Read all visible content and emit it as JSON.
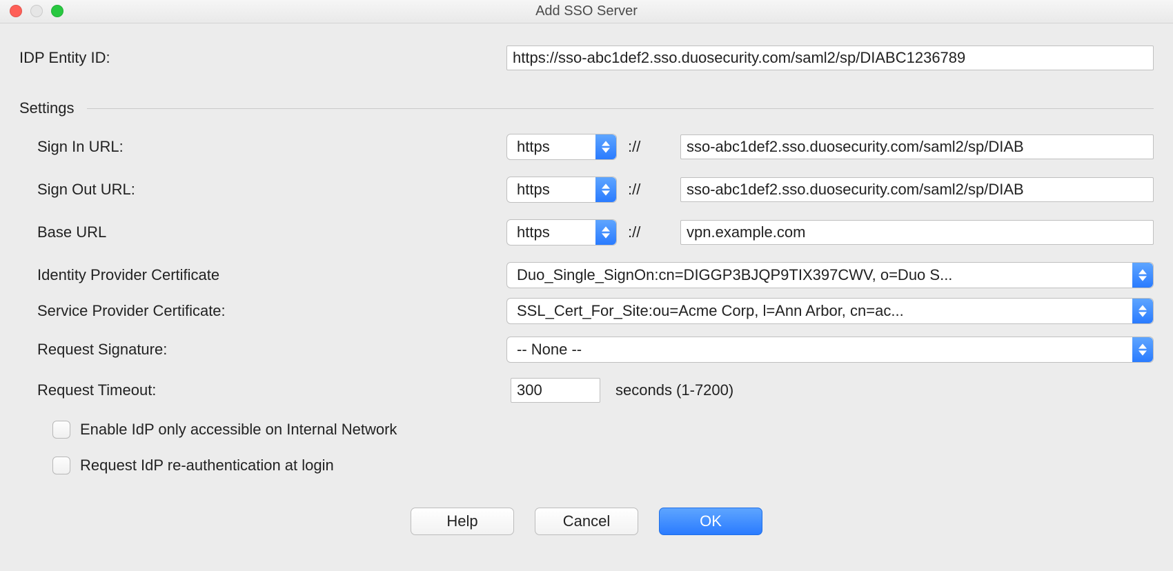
{
  "window": {
    "title": "Add SSO Server"
  },
  "idp_entity": {
    "label": "IDP Entity ID:",
    "value": "https://sso-abc1def2.sso.duosecurity.com/saml2/sp/DIABC1236789"
  },
  "settings": {
    "legend": "Settings",
    "sign_in": {
      "label": "Sign In URL:",
      "scheme": "https",
      "sep": "://",
      "host": "sso-abc1def2.sso.duosecurity.com/saml2/sp/DIAB"
    },
    "sign_out": {
      "label": "Sign Out URL:",
      "scheme": "https",
      "sep": "://",
      "host": "sso-abc1def2.sso.duosecurity.com/saml2/sp/DIAB"
    },
    "base": {
      "label": "Base URL",
      "scheme": "https",
      "sep": "://",
      "host": "vpn.example.com"
    },
    "idp_cert": {
      "label": "Identity Provider Certificate",
      "value": "Duo_Single_SignOn:cn=DIGGP3BJQP9TIX397CWV, o=Duo S..."
    },
    "sp_cert": {
      "label": "Service Provider Certificate:",
      "value": "SSL_Cert_For_Site:ou=Acme Corp, l=Ann Arbor, cn=ac..."
    },
    "req_sig": {
      "label": "Request Signature:",
      "value": "-- None --"
    },
    "timeout": {
      "label": "Request Timeout:",
      "value": "300",
      "suffix": "seconds (1-7200)"
    },
    "chk_internal": {
      "label": "Enable IdP only accessible on Internal Network"
    },
    "chk_reauth": {
      "label": "Request IdP re-authentication at login"
    }
  },
  "buttons": {
    "help": "Help",
    "cancel": "Cancel",
    "ok": "OK"
  }
}
